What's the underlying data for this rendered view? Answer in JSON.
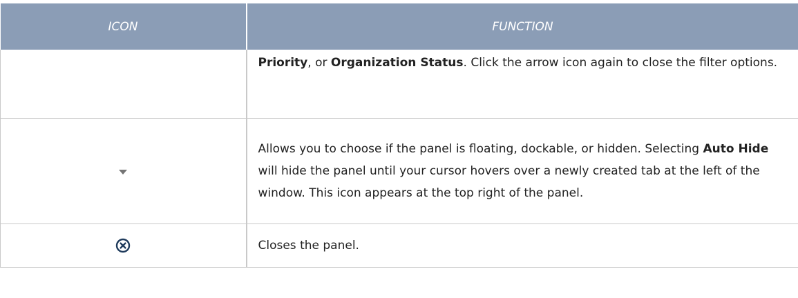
{
  "table": {
    "header": {
      "icon_label": "ICON",
      "function_label": "FUNCTION"
    },
    "rows": [
      {
        "icon": "",
        "segments": [
          {
            "text": "Priority",
            "bold": true
          },
          {
            "text": ", or ",
            "bold": false
          },
          {
            "text": "Organization Status",
            "bold": true
          },
          {
            "text": ". Click the arrow icon again to close the filter options.",
            "bold": false
          }
        ]
      },
      {
        "icon": "dropdown-arrow-icon",
        "segments": [
          {
            "text": "Allows you to choose if the panel is floating, dockable, or hidden. Selecting ",
            "bold": false
          },
          {
            "text": "Auto Hide",
            "bold": true
          },
          {
            "text": " will hide the panel until your cursor hovers over a newly created tab at the left of the window. This icon appears at the top right of the panel.",
            "bold": false
          }
        ]
      },
      {
        "icon": "close-circle-icon",
        "segments": [
          {
            "text": "Closes the panel.",
            "bold": false
          }
        ]
      }
    ]
  },
  "colors": {
    "header_bg": "#8b9db6",
    "header_text": "#ffffff",
    "border": "#c9c9c9",
    "body_text": "#222222",
    "icon_dark": "#1f3b5c",
    "icon_gray": "#757575"
  }
}
